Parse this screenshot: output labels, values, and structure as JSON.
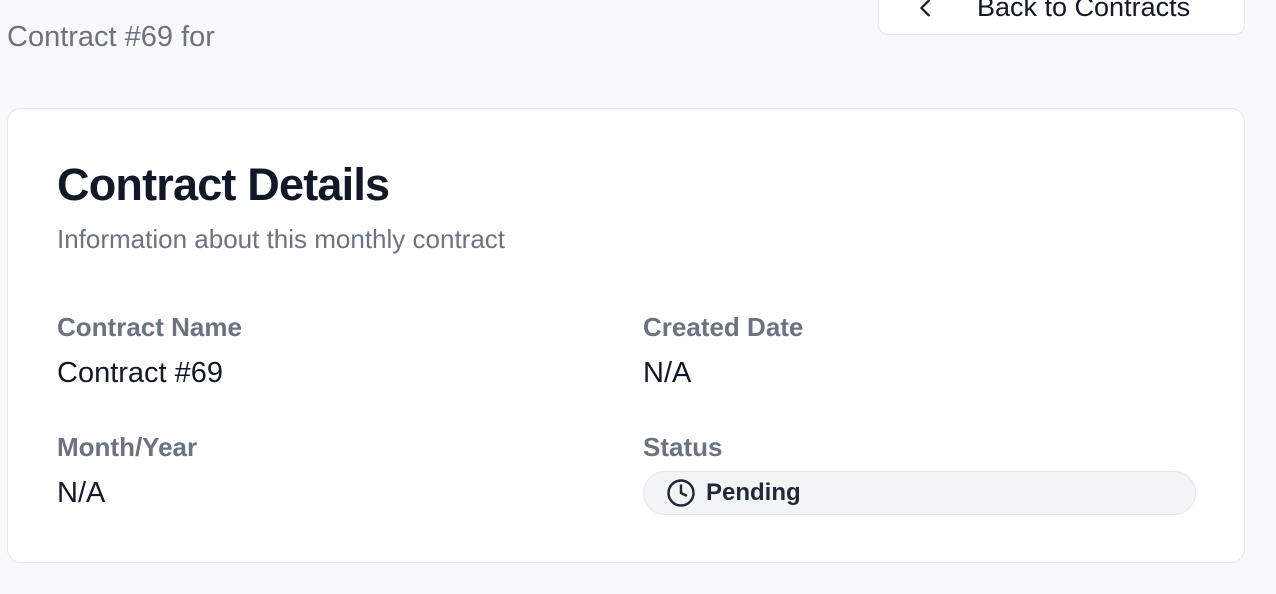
{
  "header": {
    "subtitle": "Contract #69 for",
    "back_button_label": "Back to Contracts"
  },
  "card": {
    "title": "Contract Details",
    "description": "Information about this monthly contract",
    "fields": {
      "contract_name": {
        "label": "Contract Name",
        "value": "Contract #69"
      },
      "created_date": {
        "label": "Created Date",
        "value": "N/A"
      },
      "month_year": {
        "label": "Month/Year",
        "value": "N/A"
      },
      "status": {
        "label": "Status",
        "value": "Pending",
        "icon": "clock-icon"
      }
    }
  },
  "colors": {
    "background": "#f8f9fb",
    "card_bg": "#ffffff",
    "muted_text": "#6b7280",
    "primary_text": "#111827",
    "pill_bg": "#f3f4f6"
  }
}
